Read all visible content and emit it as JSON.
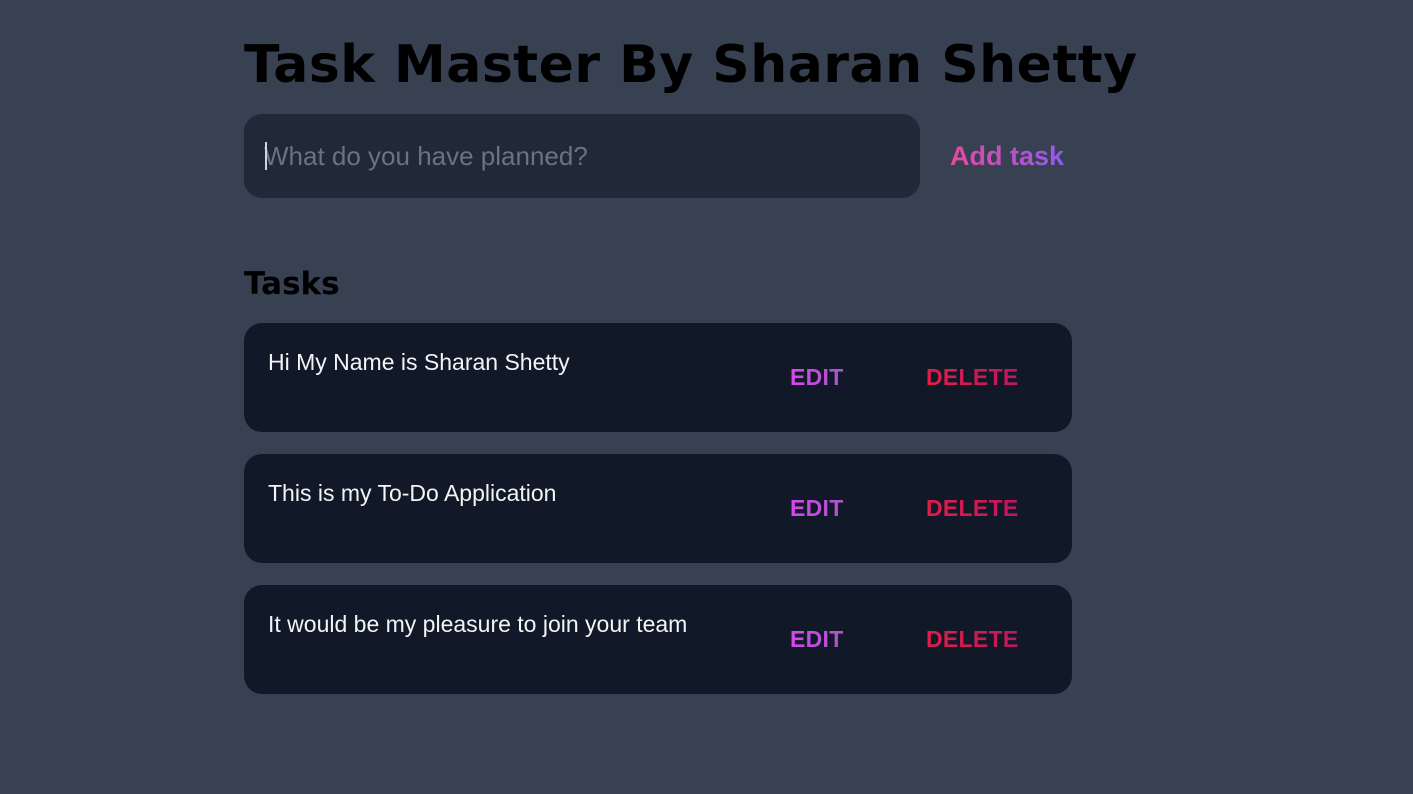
{
  "header": {
    "title": "Task Master By Sharan Shetty"
  },
  "form": {
    "input_placeholder": "What do you have planned?",
    "input_value": "",
    "add_label": "Add task"
  },
  "tasks_section": {
    "heading": "Tasks",
    "items": [
      {
        "text": "Hi My Name is Sharan Shetty",
        "edit_label": "EDIT",
        "delete_label": "DELETE"
      },
      {
        "text": "This is my To-Do Application",
        "edit_label": "EDIT",
        "delete_label": "DELETE"
      },
      {
        "text": "It would be my pleasure to join your team",
        "edit_label": "EDIT",
        "delete_label": "DELETE"
      }
    ]
  },
  "colors": {
    "background": "#374151",
    "input_background": "#1f2937",
    "task_background": "#111827",
    "add_gradient_start": "#ec4899",
    "add_gradient_end": "#8b5cf6",
    "edit_color": "#c94fc6",
    "delete_color": "#e11d48"
  }
}
